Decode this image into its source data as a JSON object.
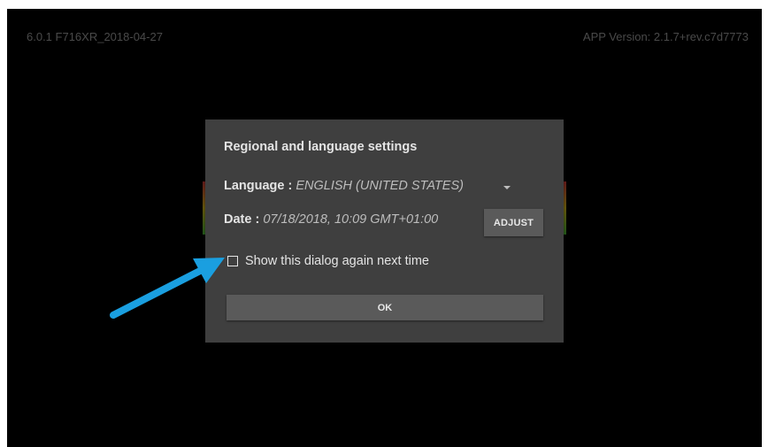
{
  "header": {
    "firmware_version": "6.0.1 F716XR_2018-04-27",
    "app_version": "APP Version: 2.1.7+rev.c7d7773"
  },
  "dialog": {
    "title": "Regional and language settings",
    "language_label": "Language : ",
    "language_value": "ENGLISH (UNITED STATES)",
    "date_label": "Date : ",
    "date_value": "07/18/2018, 10:09 GMT+01:00",
    "adjust_label": "ADJUST",
    "checkbox_label": "Show this dialog again next time",
    "checkbox_checked": false,
    "ok_label": "OK"
  },
  "colors": {
    "screen_background": "#000000",
    "dialog_background": "#3f3f3f",
    "button_background": "#5a5a5a",
    "annotation_arrow": "#1a9fe0"
  }
}
